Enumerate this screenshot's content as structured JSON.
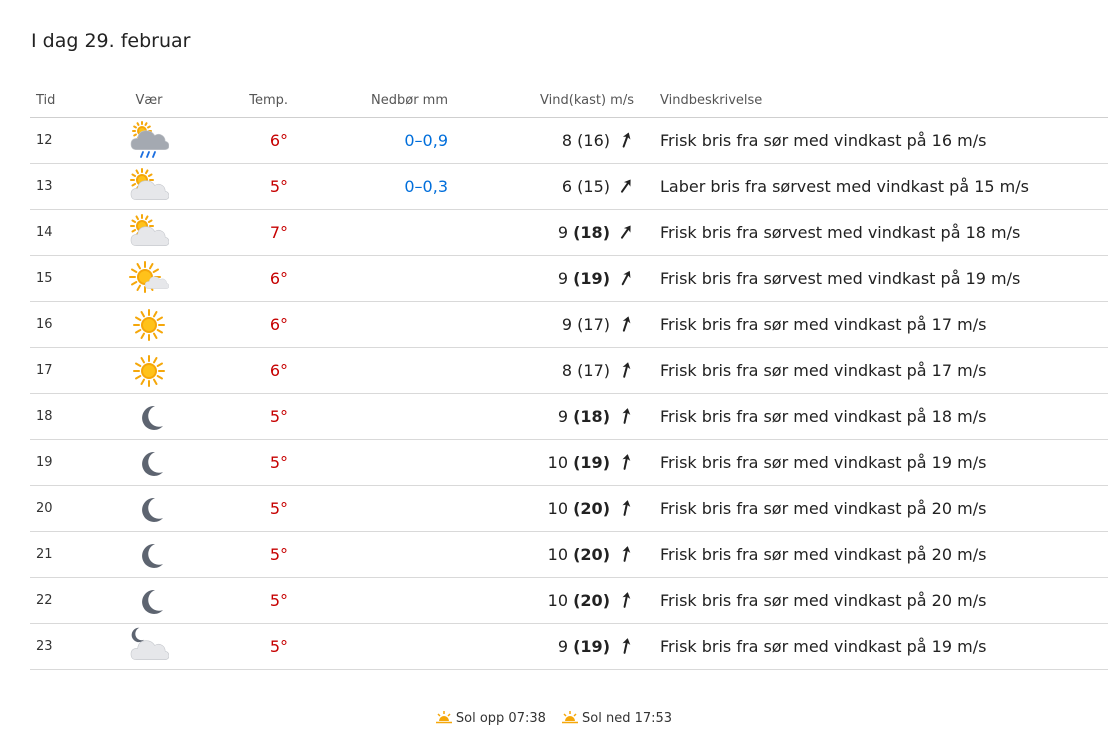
{
  "title": "I dag 29. februar",
  "headers": {
    "tid": "Tid",
    "var": "Vær",
    "temp": "Temp.",
    "nedbor": "Nedbør mm",
    "vind": "Vind(kast) m/s",
    "desc": "Vindbeskrivelse"
  },
  "colors": {
    "temp": "#c60000",
    "precip": "#006edb",
    "sun": "#f5a70a",
    "cloud": "#dcdee2",
    "rain_cloud": "#a4a9b1",
    "moon": "#5d6470"
  },
  "rows": [
    {
      "time": "12",
      "icon": "rain-cloud-sun",
      "temp": "6°",
      "precip": "0–0,9",
      "wind": "8",
      "gust": "(16)",
      "gust_bold": false,
      "dir": 20,
      "desc": "Frisk bris fra sør med vindkast på 16 m/s"
    },
    {
      "time": "13",
      "icon": "partly-cloudy",
      "temp": "5°",
      "precip": "0–0,3",
      "wind": "6",
      "gust": "(15)",
      "gust_bold": false,
      "dir": 35,
      "desc": "Laber bris fra sørvest med vindkast på 15 m/s"
    },
    {
      "time": "14",
      "icon": "partly-cloudy",
      "temp": "7°",
      "precip": "",
      "wind": "9",
      "gust": "(18)",
      "gust_bold": true,
      "dir": 35,
      "desc": "Frisk bris fra sørvest med vindkast på 18 m/s"
    },
    {
      "time": "15",
      "icon": "sun-small-cloud",
      "temp": "6°",
      "precip": "",
      "wind": "9",
      "gust": "(19)",
      "gust_bold": true,
      "dir": 28,
      "desc": "Frisk bris fra sørvest med vindkast på 19 m/s"
    },
    {
      "time": "16",
      "icon": "sun",
      "temp": "6°",
      "precip": "",
      "wind": "9",
      "gust": "(17)",
      "gust_bold": false,
      "dir": 18,
      "desc": "Frisk bris fra sør med vindkast på 17 m/s"
    },
    {
      "time": "17",
      "icon": "sun",
      "temp": "6°",
      "precip": "",
      "wind": "8",
      "gust": "(17)",
      "gust_bold": false,
      "dir": 15,
      "desc": "Frisk bris fra sør med vindkast på 17 m/s"
    },
    {
      "time": "18",
      "icon": "moon",
      "temp": "5°",
      "precip": "",
      "wind": "9",
      "gust": "(18)",
      "gust_bold": true,
      "dir": 12,
      "desc": "Frisk bris fra sør med vindkast på 18 m/s"
    },
    {
      "time": "19",
      "icon": "moon",
      "temp": "5°",
      "precip": "",
      "wind": "10",
      "gust": "(19)",
      "gust_bold": true,
      "dir": 12,
      "desc": "Frisk bris fra sør med vindkast på 19 m/s"
    },
    {
      "time": "20",
      "icon": "moon",
      "temp": "5°",
      "precip": "",
      "wind": "10",
      "gust": "(20)",
      "gust_bold": true,
      "dir": 12,
      "desc": "Frisk bris fra sør med vindkast på 20 m/s"
    },
    {
      "time": "21",
      "icon": "moon",
      "temp": "5°",
      "precip": "",
      "wind": "10",
      "gust": "(20)",
      "gust_bold": true,
      "dir": 12,
      "desc": "Frisk bris fra sør med vindkast på 20 m/s"
    },
    {
      "time": "22",
      "icon": "moon",
      "temp": "5°",
      "precip": "",
      "wind": "10",
      "gust": "(20)",
      "gust_bold": true,
      "dir": 12,
      "desc": "Frisk bris fra sør med vindkast på 20 m/s"
    },
    {
      "time": "23",
      "icon": "moon-cloud",
      "temp": "5°",
      "precip": "",
      "wind": "9",
      "gust": "(19)",
      "gust_bold": true,
      "dir": 12,
      "desc": "Frisk bris fra sør med vindkast på 19 m/s"
    }
  ],
  "footer": {
    "sunrise": "Sol opp 07:38",
    "sunset": "Sol ned 17:53",
    "sunrise_icon": "sunrise-icon",
    "sunset_icon": "sunset-icon"
  }
}
